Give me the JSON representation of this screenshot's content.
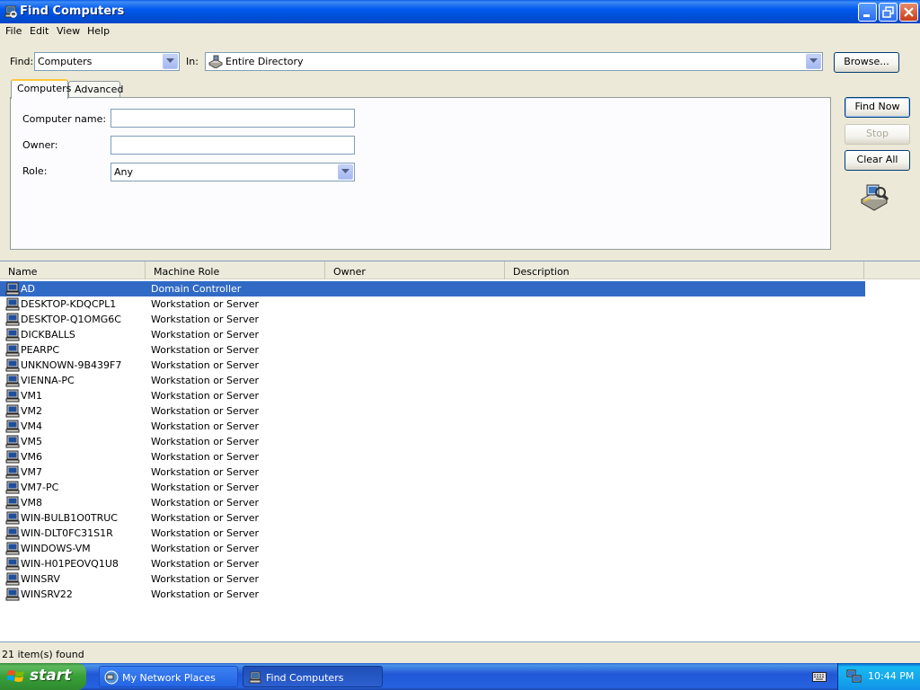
{
  "window": {
    "title": "Find Computers"
  },
  "menu": [
    "File",
    "Edit",
    "View",
    "Help"
  ],
  "find_row": {
    "find_label": "Find:",
    "find_value": "Computers",
    "in_label": "In:",
    "in_value": "Entire Directory",
    "browse_label": "Browse..."
  },
  "tabs": [
    "Computers",
    "Advanced"
  ],
  "form": {
    "computer_name_label": "Computer name:",
    "computer_name_value": "",
    "owner_label": "Owner:",
    "owner_value": "",
    "role_label": "Role:",
    "role_value": "Any"
  },
  "actions": {
    "find_now": "Find Now",
    "stop": "Stop",
    "clear_all": "Clear All"
  },
  "columns": [
    "Name",
    "Machine Role",
    "Owner",
    "Description"
  ],
  "results": [
    {
      "name": "AD",
      "role": "Domain Controller",
      "selected": true
    },
    {
      "name": "DESKTOP-KDQCPL1",
      "role": "Workstation or Server"
    },
    {
      "name": "DESKTOP-Q1OMG6C",
      "role": "Workstation or Server"
    },
    {
      "name": "DICKBALLS",
      "role": "Workstation or Server"
    },
    {
      "name": "PEARPC",
      "role": "Workstation or Server"
    },
    {
      "name": "UNKNOWN-9B439F7",
      "role": "Workstation or Server"
    },
    {
      "name": "VIENNA-PC",
      "role": "Workstation or Server"
    },
    {
      "name": "VM1",
      "role": "Workstation or Server"
    },
    {
      "name": "VM2",
      "role": "Workstation or Server"
    },
    {
      "name": "VM4",
      "role": "Workstation or Server"
    },
    {
      "name": "VM5",
      "role": "Workstation or Server"
    },
    {
      "name": "VM6",
      "role": "Workstation or Server"
    },
    {
      "name": "VM7",
      "role": "Workstation or Server"
    },
    {
      "name": "VM7-PC",
      "role": "Workstation or Server"
    },
    {
      "name": "VM8",
      "role": "Workstation or Server"
    },
    {
      "name": "WIN-BULB1O0TRUC",
      "role": "Workstation or Server"
    },
    {
      "name": "WIN-DLT0FC31S1R",
      "role": "Workstation or Server"
    },
    {
      "name": "WINDOWS-VM",
      "role": "Workstation or Server"
    },
    {
      "name": "WIN-H01PEOVQ1U8",
      "role": "Workstation or Server"
    },
    {
      "name": "WINSRV",
      "role": "Workstation or Server"
    },
    {
      "name": "WINSRV22",
      "role": "Workstation or Server"
    }
  ],
  "status": {
    "text": "21 item(s) found"
  },
  "taskbar": {
    "start_label": "start",
    "tasks": [
      "My Network Places",
      "Find Computers"
    ],
    "clock": "10:44 PM"
  },
  "colors": {
    "selection": "#316ac5",
    "titlebar": "#0058ee",
    "taskbar": "#2157d7",
    "start_button": "#38a038"
  },
  "icons": {
    "app": "find-computers-icon",
    "row": "computer-icon",
    "search_graphic": "search-computers-graphic",
    "keyboard": "keyboard-icon",
    "network": "network-tray-icon"
  }
}
